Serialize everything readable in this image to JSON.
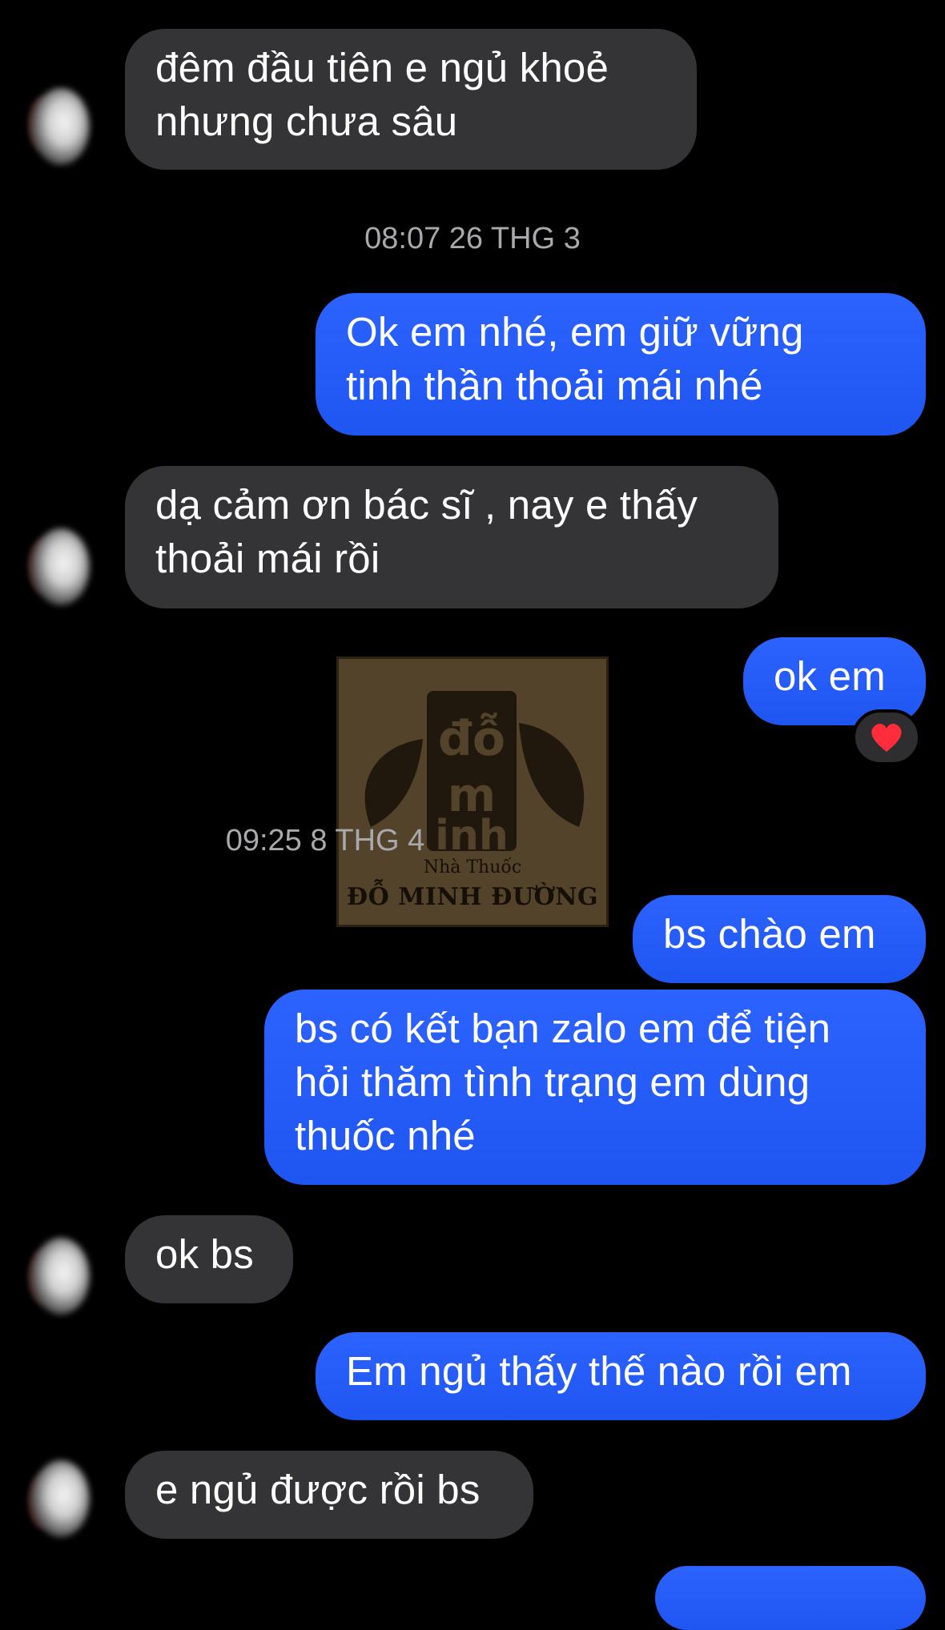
{
  "messages": [
    {
      "id": "m1",
      "from": "contact",
      "text": "đêm đầu tiên e ngủ khoẻ\nnhưng chưa sâu"
    },
    {
      "id": "m2",
      "from": "me",
      "text": "Ok em nhé,  em    giữ vững\ntinh thần thoải mái nhé"
    },
    {
      "id": "m3",
      "from": "contact",
      "text": "dạ cảm ơn bác sĩ , nay e thấy\nthoải mái rồi"
    },
    {
      "id": "m4",
      "from": "me",
      "text": "ok em",
      "reaction": "❤️"
    },
    {
      "id": "m5",
      "from": "me",
      "text": "bs chào em"
    },
    {
      "id": "m6",
      "from": "me",
      "text": "bs có kết bạn zalo em để tiện\nhỏi thăm tình trạng em dùng\nthuốc nhé"
    },
    {
      "id": "m7",
      "from": "contact",
      "text": "ok bs"
    },
    {
      "id": "m8",
      "from": "me",
      "text": "Em ngủ thấy thế nào rồi em"
    },
    {
      "id": "m9",
      "from": "contact",
      "text": "e ngủ được rồi bs"
    }
  ],
  "timestamps": {
    "t1": "08:07 26 THG 3",
    "t2": "09:25 8 THG 4"
  },
  "watermark": {
    "logo_text": "đỗ minh",
    "line1": "Nhà Thuốc",
    "line2": "ĐỖ MINH ĐƯỜNG"
  },
  "colors": {
    "background": "#000000",
    "incoming_bubble": "#343436",
    "outgoing_bubble": "#2c63ff",
    "timestamp_text": "#a8a8ad"
  },
  "icons": {
    "reaction": "heart-icon",
    "avatar": "blurred-avatar"
  }
}
